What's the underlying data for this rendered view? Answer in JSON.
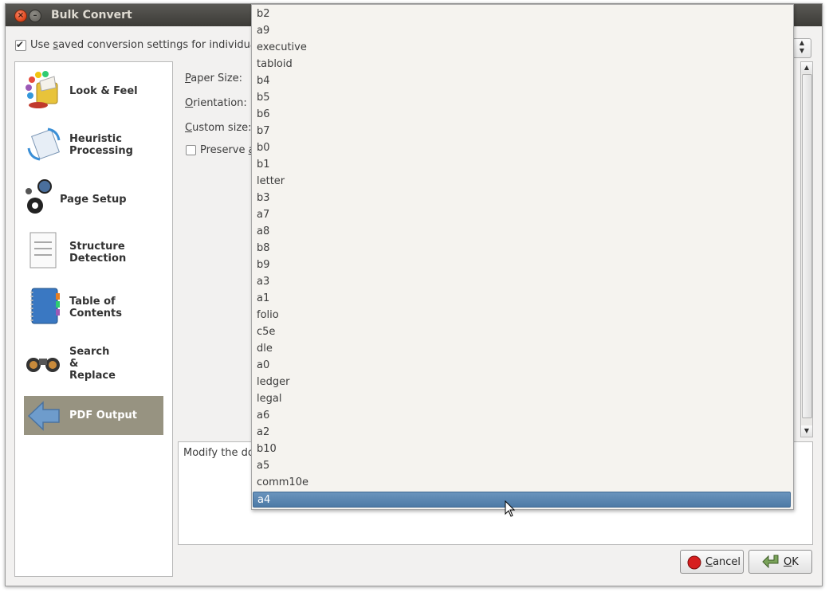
{
  "window": {
    "title": "Bulk Convert",
    "close_glyph": "×",
    "min_glyph": "–"
  },
  "top_checkbox": {
    "checked": true,
    "label_visible": "Use saved conversion settings for individual bo"
  },
  "sidebar": {
    "items": [
      {
        "label": "Look & Feel",
        "icon": "palette-icon"
      },
      {
        "label": "Heuristic\nProcessing",
        "icon": "heuristic-icon"
      },
      {
        "label": "Page Setup",
        "icon": "gears-icon"
      },
      {
        "label": "Structure\nDetection",
        "icon": "document-icon"
      },
      {
        "label": "Table of\nContents",
        "icon": "notebook-icon"
      },
      {
        "label": "Search\n&\nReplace",
        "icon": "binoculars-icon"
      },
      {
        "label": "PDF Output",
        "icon": "arrow-left-icon",
        "selected": true
      }
    ]
  },
  "form": {
    "paper_size_label": "Paper Size:",
    "orientation_label": "Orientation:",
    "custom_size_label": "Custom size:",
    "preserve_label_visible": "Preserve a",
    "preserve_checked": false
  },
  "description_visible": "Modify the doc",
  "buttons": {
    "cancel": "Cancel",
    "ok": "OK"
  },
  "dropdown": {
    "options": [
      "b2",
      "a9",
      "executive",
      "tabloid",
      "b4",
      "b5",
      "b6",
      "b7",
      "b0",
      "b1",
      "letter",
      "b3",
      "a7",
      "a8",
      "b8",
      "b9",
      "a3",
      "a1",
      "folio",
      "c5e",
      "dle",
      "a0",
      "ledger",
      "legal",
      "a6",
      "a2",
      "b10",
      "a5",
      "comm10e",
      "a4"
    ],
    "highlighted": "a4"
  },
  "colors": {
    "selection": "#5582af",
    "sidebar_selected": "#979381",
    "titlebar": "#3c3b37"
  }
}
